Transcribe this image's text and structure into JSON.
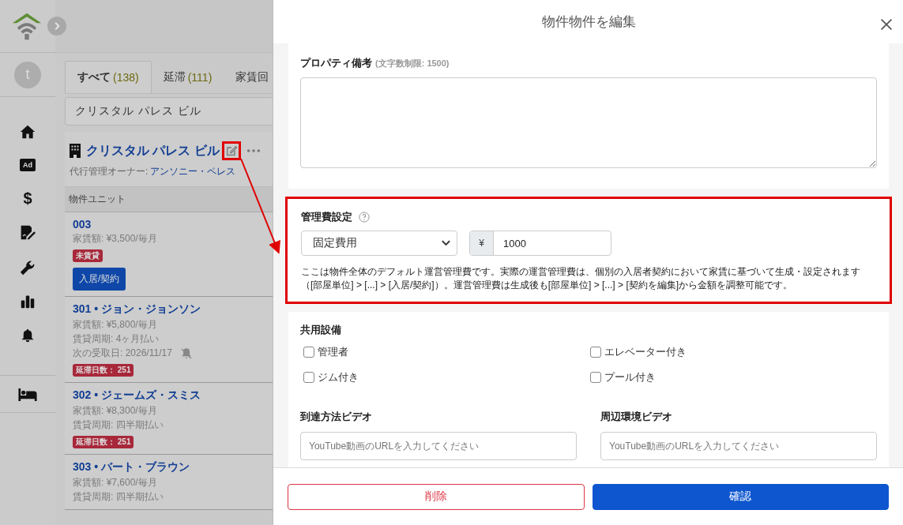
{
  "sidebar": {
    "avatar": "t",
    "items": [
      {
        "kind": "home"
      },
      {
        "kind": "badge",
        "label": "Ad"
      },
      {
        "kind": "glyph",
        "label": "$"
      },
      {
        "kind": "contract"
      },
      {
        "kind": "wrench"
      },
      {
        "kind": "chart"
      },
      {
        "kind": "bell"
      }
    ],
    "bottom_items": [
      {
        "kind": "bed"
      }
    ]
  },
  "tabs": [
    {
      "label": "すべて",
      "count": "(138)",
      "selected": true
    },
    {
      "label": "延滞",
      "count": "(111)",
      "selected": false
    },
    {
      "label": "家賃回",
      "selected": false
    }
  ],
  "search": {
    "value": "クリスタル パレス ビル"
  },
  "property": {
    "name": "クリスタル パレス ビル",
    "owner_label": "代行管理オーナー:",
    "owner": "アンソニー・ペレス",
    "units_heading": "物件ユニット"
  },
  "units": [
    {
      "title": "003",
      "details": [
        {
          "kind": "text",
          "text": "家賃額: ¥3,500/毎月"
        }
      ],
      "badge": "未賃貸",
      "action": "入居/契約"
    },
    {
      "title": "301 • ジョン・ジョンソン",
      "details": [
        {
          "kind": "text",
          "text": "家賃額: ¥5,800/毎月"
        },
        {
          "kind": "text",
          "text": "賃貸周期: 4ヶ月払い"
        },
        {
          "kind": "date",
          "text": "次の受取日:  2026/11/17"
        }
      ],
      "badge": "延滞日数： 251"
    },
    {
      "title": "302 • ジェームズ・スミス",
      "details": [
        {
          "kind": "text",
          "text": "家賃額: ¥8,300/毎月"
        },
        {
          "kind": "text",
          "text": "賃貸周期: 四半期払い"
        }
      ],
      "badge": "延滞日数： 251"
    },
    {
      "title": "303 • バート・ブラウン",
      "details": [
        {
          "kind": "text",
          "text": "家賃額: ¥7,600/毎月"
        },
        {
          "kind": "text",
          "text": "賃貸周期: 四半期払い"
        }
      ]
    }
  ],
  "modal": {
    "title": "物件物件を編集",
    "notes": {
      "label": "プロパティ備考",
      "hint": "(文字数制限: 1500)"
    },
    "fee": {
      "label": "管理費設定",
      "type": "固定費用",
      "currency": "¥",
      "amount": "1000",
      "help": "ここは物件全体のデフォルト運営管理費です。実際の運営管理費は、個別の入居者契約において家賃に基づいて生成・設定されます（[部屋単位] > [...] > [入居/契約]）。運営管理費は生成後も[部屋単位] > [...] > [契約を編集]から金額を調整可能です。"
    },
    "amenities": {
      "label": "共用設備",
      "items": [
        {
          "label": "管理者",
          "checked": false
        },
        {
          "label": "エレベーター付き",
          "checked": false
        },
        {
          "label": "ジム付き",
          "checked": false
        },
        {
          "label": "プール付き",
          "checked": false
        }
      ]
    },
    "videos": [
      {
        "label": "到達方法ビデオ",
        "placeholder": "YouTube動画のURLを入力してください"
      },
      {
        "label": "周辺環境ビデオ",
        "placeholder": "YouTube動画のURLを入力してください"
      }
    ],
    "buttons": {
      "delete": "削除",
      "confirm": "確認"
    }
  }
}
